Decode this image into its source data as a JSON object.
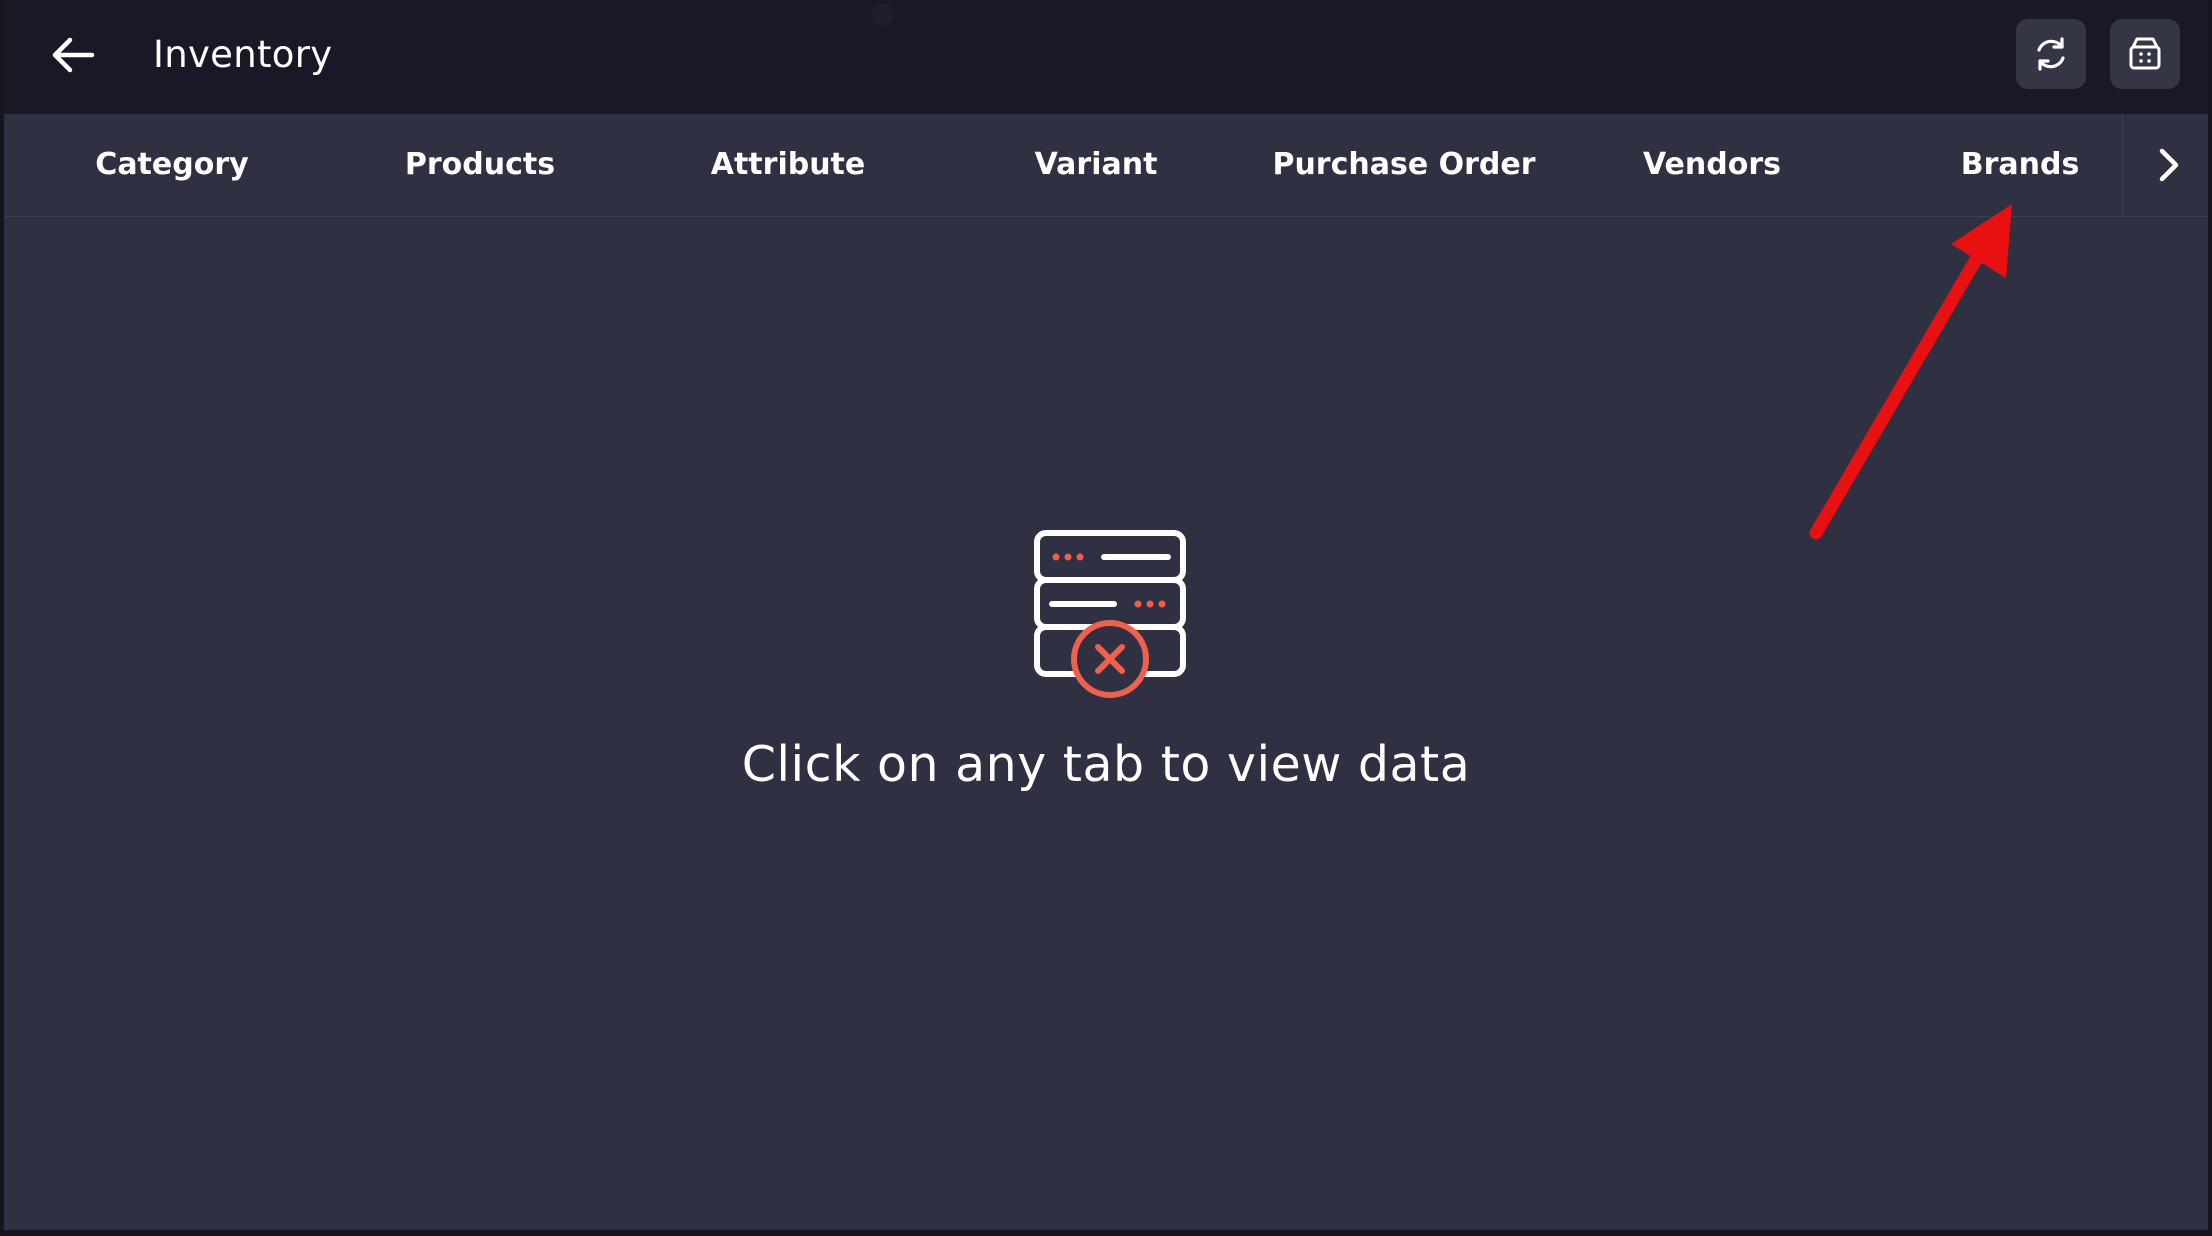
{
  "header": {
    "title": "Inventory",
    "back_icon": "arrow-left-icon",
    "refresh_icon": "refresh-icon",
    "store_icon": "store-icon"
  },
  "tabs": [
    {
      "label": "Category"
    },
    {
      "label": "Products"
    },
    {
      "label": "Attribute"
    },
    {
      "label": "Variant"
    },
    {
      "label": "Purchase Order"
    },
    {
      "label": "Vendors"
    },
    {
      "label": "Brands"
    }
  ],
  "tabs_next_icon": "chevron-right-icon",
  "empty_state": {
    "icon": "server-error-icon",
    "message": "Click on any tab to view data"
  },
  "colors": {
    "header_bg": "#181827",
    "content_bg": "#2f3142",
    "accent": "#f0604d",
    "annotation_arrow": "#e81010"
  }
}
